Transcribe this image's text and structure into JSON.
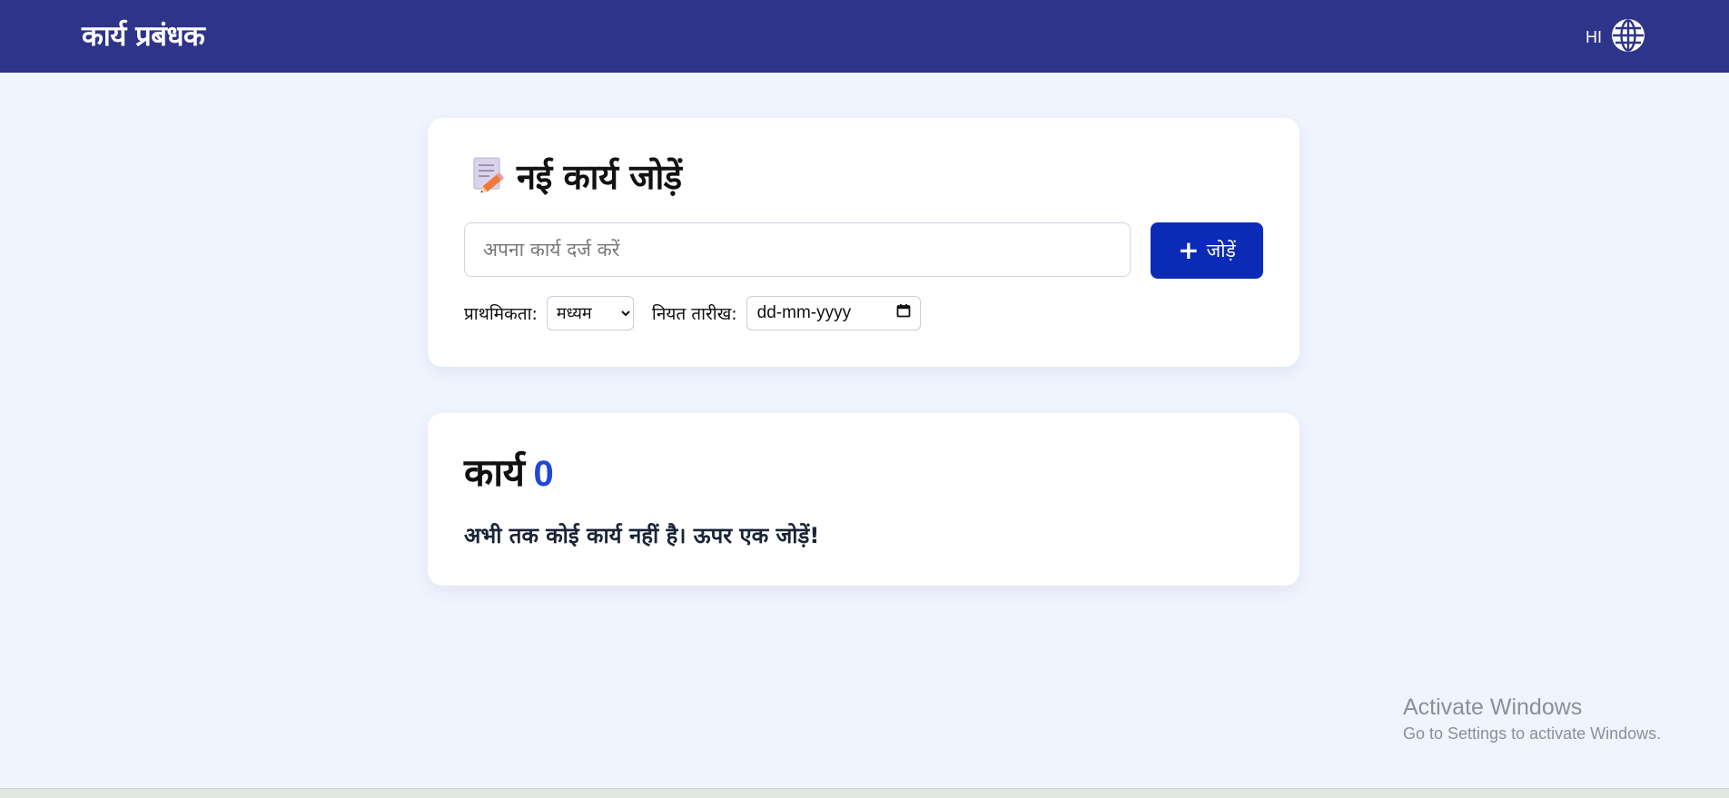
{
  "header": {
    "brand": "कार्य प्रबंधक",
    "language_code": "HI",
    "language_icon": "globe-icon"
  },
  "add_card": {
    "title_icon": "memo-icon",
    "title": "नई कार्य जोड़ें",
    "input_placeholder": "अपना कार्य दर्ज करें",
    "input_value": "",
    "add_button_icon": "plus-icon",
    "add_button_label": "जोड़ें",
    "priority_label": "प्राथमिकता:",
    "priority_selected": "मध्यम",
    "due_date_label": "नियत तारीख:",
    "due_date_placeholder": "dd-mm-yyyy",
    "due_date_icon": "calendar-icon"
  },
  "task_list": {
    "title": "कार्य",
    "count": "0",
    "empty_message": "अभी तक कोई कार्य नहीं है। ऊपर एक जोड़ें!"
  },
  "os_watermark": {
    "line1": "Activate Windows",
    "line2": "Go to Settings to activate Windows."
  },
  "colors": {
    "header_bg": "#2e3489",
    "page_bg": "#f0f4fd",
    "primary_button": "#0b2bb7",
    "count_accent": "#1f47d8"
  }
}
